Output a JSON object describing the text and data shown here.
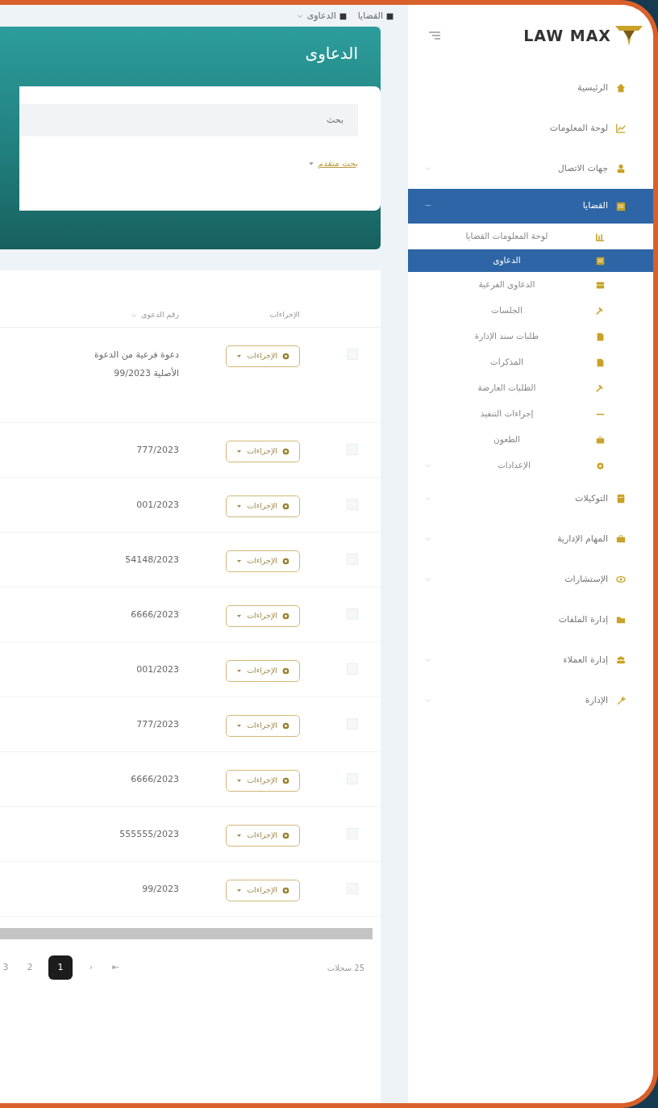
{
  "breadcrumb": [
    {
      "label": "القضايا",
      "dropdown": false
    },
    {
      "label": "الدعاوى",
      "dropdown": true
    }
  ],
  "logo": {
    "text": "LAW MAX"
  },
  "sidebar": {
    "items": [
      {
        "label": "الرئيسية",
        "kind": "link",
        "selected": false
      },
      {
        "label": "لوحة المعلومات",
        "kind": "link",
        "selected": false
      },
      {
        "label": "جهات الاتصال",
        "kind": "group",
        "expanded": false,
        "selected": false
      },
      {
        "label": "القضايا",
        "kind": "group",
        "expanded": true,
        "selected": true,
        "children": [
          {
            "label": "لوحة المعلومات القضايا",
            "kind": "link",
            "selected": false
          },
          {
            "label": "الدعاوى",
            "kind": "link",
            "selected": true
          },
          {
            "label": "الدعاوى الفرعية",
            "kind": "link",
            "selected": false
          },
          {
            "label": "الجلسات",
            "kind": "link",
            "selected": false
          },
          {
            "label": "طلبات سند الإدارة",
            "kind": "link",
            "selected": false
          },
          {
            "label": "المذكرات",
            "kind": "link",
            "selected": false
          },
          {
            "label": "الطلبات العارضة",
            "kind": "link",
            "selected": false
          },
          {
            "label": "إجراءات التنفيذ",
            "kind": "link",
            "selected": false
          },
          {
            "label": "الطعون",
            "kind": "link",
            "selected": false
          },
          {
            "label": "الإعدادات",
            "kind": "group",
            "expanded": false,
            "selected": false
          }
        ]
      },
      {
        "label": "التوكيلات",
        "kind": "group",
        "expanded": false,
        "selected": false
      },
      {
        "label": "المهام الإدارية",
        "kind": "group",
        "expanded": false,
        "selected": false
      },
      {
        "label": "الإستشارات",
        "kind": "group",
        "expanded": false,
        "selected": false
      },
      {
        "label": "إدارة الملفات",
        "kind": "link",
        "selected": false
      },
      {
        "label": "إدارة العملاء",
        "kind": "group",
        "expanded": false,
        "selected": false
      },
      {
        "label": "الإدارة",
        "kind": "group",
        "expanded": false,
        "selected": false
      }
    ]
  },
  "page": {
    "title": "الدعاوى"
  },
  "search": {
    "placeholder": "بحث",
    "advanced_link": "بحث متقدم"
  },
  "table": {
    "columns": [
      "الإجراءات",
      "رقم الدعوى"
    ],
    "rows": [
      {
        "checked": false,
        "action": "الإجراءات",
        "case_number": "دعوة فرعية من الدعوة الأصلية 99/2023"
      },
      {
        "checked": false,
        "action": "الإجراءات",
        "case_number": "777/2023"
      },
      {
        "checked": false,
        "action": "الإجراءات",
        "case_number": "001/2023"
      },
      {
        "checked": false,
        "action": "الإجراءات",
        "case_number": "54148/2023"
      },
      {
        "checked": false,
        "action": "الإجراءات",
        "case_number": "6666/2023"
      },
      {
        "checked": false,
        "action": "الإجراءات",
        "case_number": "001/2023"
      },
      {
        "checked": false,
        "action": "الإجراءات",
        "case_number": "777/2023"
      },
      {
        "checked": false,
        "action": "الإجراءات",
        "case_number": "6666/2023"
      },
      {
        "checked": false,
        "action": "الإجراءات",
        "case_number": "555555/2023"
      },
      {
        "checked": false,
        "action": "الإجراءات",
        "case_number": "99/2023"
      }
    ]
  },
  "pagination": {
    "total": "25 سجلات",
    "first": "⇤",
    "prev": "‹",
    "pages": [
      {
        "label": "1",
        "selected": true
      },
      {
        "label": "2",
        "selected": false
      },
      {
        "label": "3",
        "selected": false
      }
    ]
  }
}
